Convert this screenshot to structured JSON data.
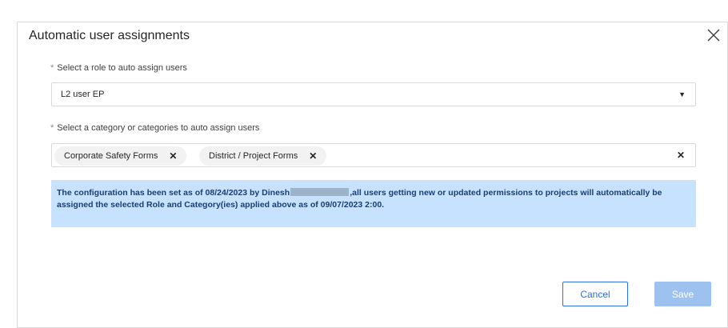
{
  "dialog": {
    "title": "Automatic user assignments",
    "close_icon": "close-icon"
  },
  "role": {
    "label": "Select a role to auto assign users",
    "required_marker": "*",
    "value": "L2 user EP",
    "caret_icon": "caret-down-icon"
  },
  "category": {
    "label": "Select a category or categories to auto assign users",
    "required_marker": "*",
    "tags": [
      {
        "label": "Corporate Safety Forms"
      },
      {
        "label": "District / Project Forms"
      }
    ],
    "tag_remove_glyph": "✕",
    "clear_glyph": "✕"
  },
  "info": {
    "text_before": "The configuration has been set as of 08/24/2023 by Dinesh",
    "text_after": ",all users getting new or updated permissions to projects will automatically be assigned the selected Role and Category(ies) applied above as of 09/07/2023 2:00."
  },
  "footer": {
    "cancel_label": "Cancel",
    "save_label": "Save"
  },
  "colors": {
    "accent": "#2f6fdb",
    "info_bg": "#c6e2ff",
    "save_disabled": "#9ec2f0"
  }
}
